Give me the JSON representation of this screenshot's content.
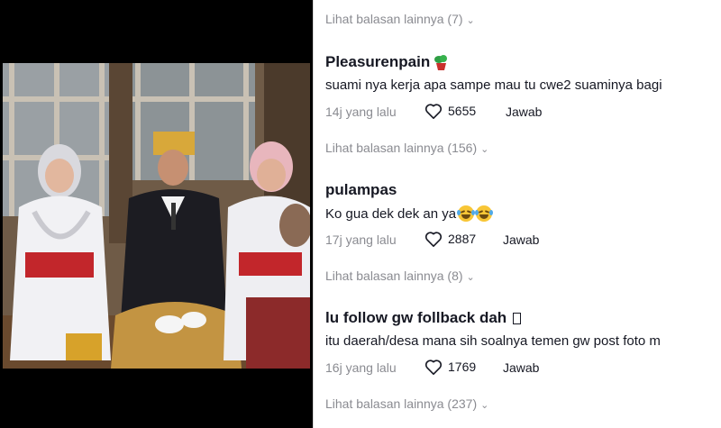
{
  "comments": [
    {
      "more_replies": "Lihat balasan lainnya (7)"
    },
    {
      "username": "Pleasurenpain",
      "text": "suami nya kerja apa sampe mau tu cwe2 suaminya bagi",
      "time": "14j yang lalu",
      "likes": "5655",
      "reply_label": "Jawab",
      "more_replies": "Lihat balasan lainnya (156)"
    },
    {
      "username": "pulampas",
      "text": "Ko gua dek dek an ya",
      "time": "17j yang lalu",
      "likes": "2887",
      "reply_label": "Jawab",
      "more_replies": "Lihat balasan lainnya (8)"
    },
    {
      "username": "lu follow gw follback dah",
      "text": "itu daerah/desa mana sih soalnya temen gw post foto m",
      "time": "16j yang lalu",
      "likes": "1769",
      "reply_label": "Jawab",
      "more_replies": "Lihat balasan lainnya (237)"
    }
  ],
  "icons": {
    "like": "heart-outline-icon",
    "expand": "chevron-down-icon",
    "emoji": "tears-of-joy-emoji-icon",
    "badge": "plant-pot-emoji-icon"
  },
  "colors": {
    "text_primary": "#161823",
    "text_secondary": "#8a8b91",
    "video_background": "#000000"
  }
}
